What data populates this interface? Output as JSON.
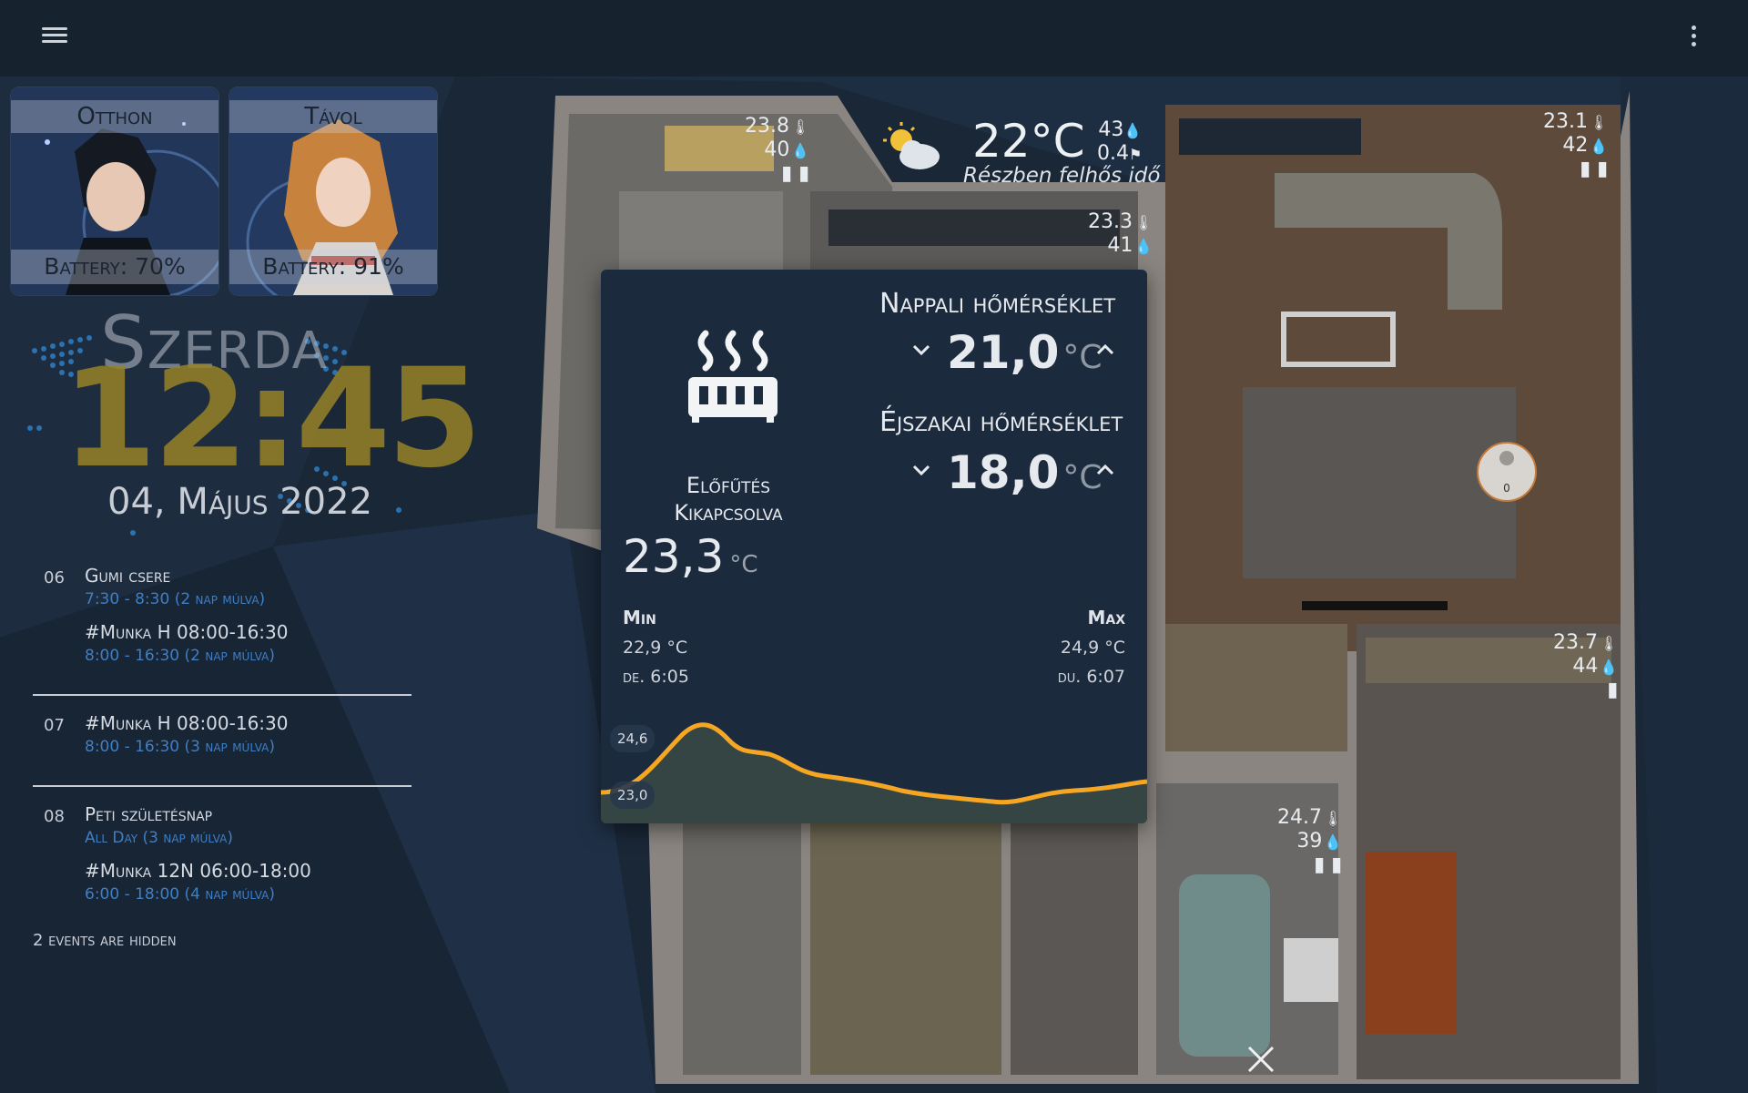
{
  "header": {
    "menu_icon": "hamburger-menu-icon",
    "more_icon": "more-vertical-icon"
  },
  "presence": [
    {
      "name": "Otthon",
      "battery": "Battery: 70%"
    },
    {
      "name": "Távol",
      "battery": "Battery: 91%"
    }
  ],
  "clock": {
    "day": "Szerda",
    "time": "12:45",
    "date": "04, Május 2022"
  },
  "calendar": {
    "days": [
      {
        "num": "06",
        "events": [
          {
            "title": "Gumi csere",
            "time": "7:30 - 8:30  (2 nap múlva)"
          },
          {
            "title": "#Munka H 08:00-16:30",
            "time": "8:00 - 16:30  (2 nap múlva)"
          }
        ]
      },
      {
        "num": "07",
        "events": [
          {
            "title": "#Munka H 08:00-16:30",
            "time": "8:00 - 16:30  (3 nap múlva)"
          }
        ]
      },
      {
        "num": "08",
        "events": [
          {
            "title": "Peti születésnap",
            "time": "All Day  (3 nap múlva)"
          },
          {
            "title": "#Munka 12N 06:00-18:00",
            "time": "6:00 - 18:00      (4 nap múlva)"
          }
        ]
      }
    ],
    "hidden_note": "2 events are hidden"
  },
  "weather": {
    "temp": "22°C",
    "condition": "Részben felhős idő",
    "humidity": "43",
    "wind": "0.4"
  },
  "sensors": [
    {
      "temp": "23.8",
      "hum": "40"
    },
    {
      "temp": "23.3",
      "hum": "41"
    },
    {
      "temp": "23.1",
      "hum": "42"
    },
    {
      "temp": "23.7",
      "hum": "44"
    },
    {
      "temp": "24.7",
      "hum": "39"
    }
  ],
  "thermostat": {
    "mode_line1": "Előfűtés",
    "mode_line2": "Kikapcsolva",
    "current": "23,3",
    "unit": "°C",
    "day_label": "Nappali hőmérséklet",
    "day_value": "21,0",
    "night_label": "Éjszakai hőmérséklet",
    "night_value": "18,0",
    "min_label": "Min",
    "min_value": "22,9 °C",
    "min_time": "de. 6:05",
    "max_label": "Max",
    "max_value": "24,9 °C",
    "max_time": "du. 6:07",
    "chart_hi": "24,6",
    "chart_lo": "23,0",
    "line_color": "#f5a623"
  },
  "robot_label": "0"
}
